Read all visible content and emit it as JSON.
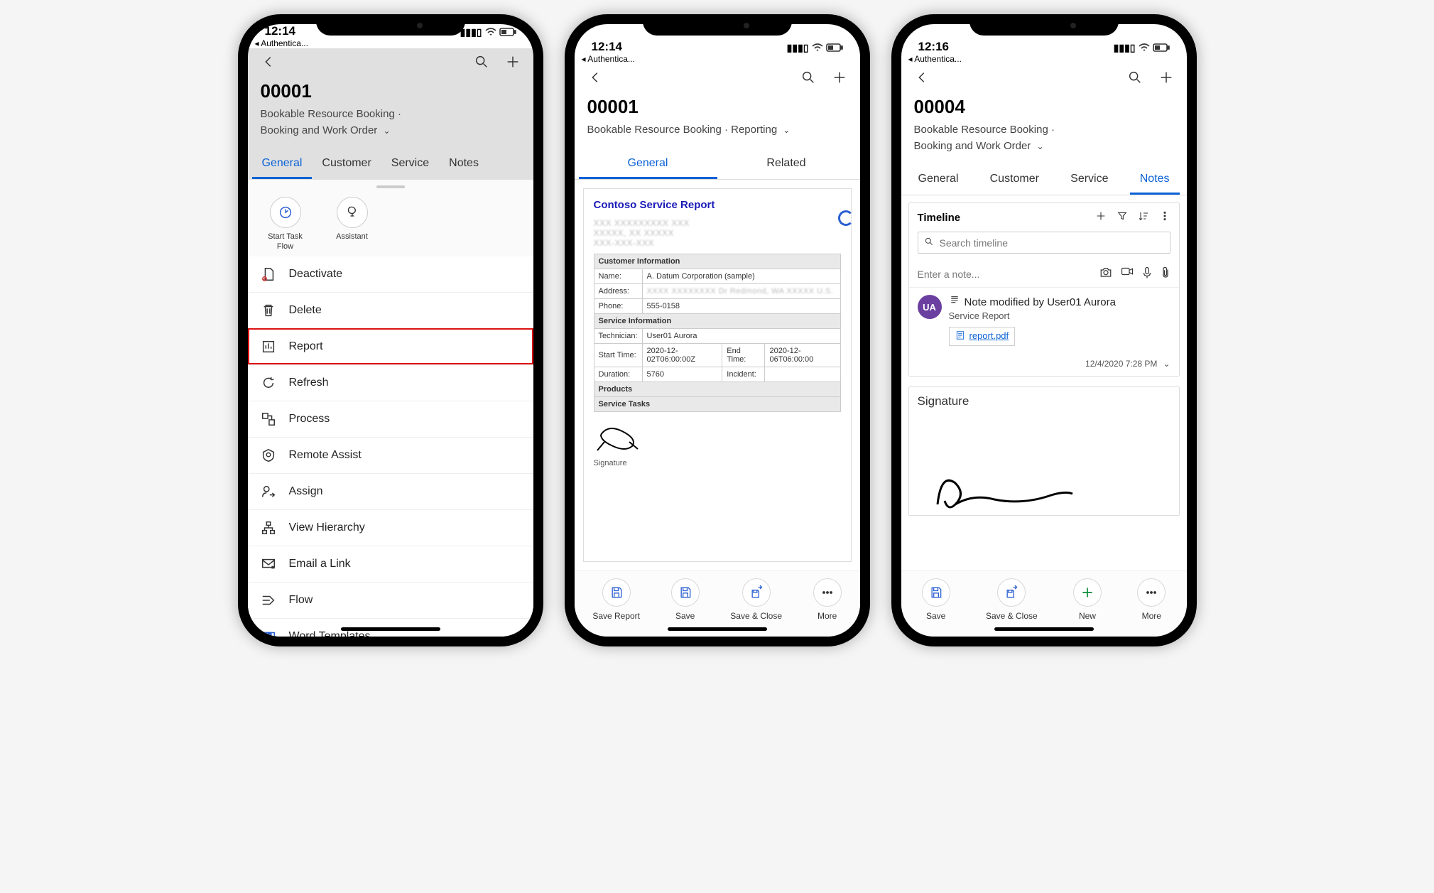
{
  "status": {
    "time1": "12:14",
    "time2": "12:14",
    "time3": "12:16",
    "back_app": "◂ Authentica..."
  },
  "phone1": {
    "title": "00001",
    "breadcrumb_line1": "Bookable Resource Booking  ·",
    "breadcrumb_line2": "Booking and Work Order",
    "tabs": [
      "General",
      "Customer",
      "Service",
      "Notes"
    ],
    "active_tab": 0,
    "quick": [
      {
        "label": "Start Task Flow"
      },
      {
        "label": "Assistant"
      }
    ],
    "menu": [
      "Deactivate",
      "Delete",
      "Report",
      "Refresh",
      "Process",
      "Remote Assist",
      "Assign",
      "View Hierarchy",
      "Email a Link",
      "Flow",
      "Word Templates"
    ],
    "highlight_index": 2
  },
  "phone2": {
    "title": "00001",
    "breadcrumb": "Bookable Resource Booking  ·  Reporting",
    "tabs": [
      "General",
      "Related"
    ],
    "active_tab": 0,
    "report": {
      "heading": "Contoso Service Report",
      "sections": {
        "cust_info": "Customer Information",
        "name_lbl": "Name:",
        "name_val": "A. Datum Corporation (sample)",
        "addr_lbl": "Address:",
        "addr_val": "",
        "phone_lbl": "Phone:",
        "phone_val": "555-0158",
        "svc_info": "Service Information",
        "tech_lbl": "Technician:",
        "tech_val": "User01 Aurora",
        "start_lbl": "Start Time:",
        "start_val": "2020-12-02T06:00:00Z",
        "end_lbl": "End Time:",
        "end_val": "2020-12-06T06:00:00",
        "dur_lbl": "Duration:",
        "dur_val": "5760",
        "inc_lbl": "Incident:",
        "inc_val": "",
        "products": "Products",
        "tasks": "Service Tasks",
        "sig_caption": "Signature"
      }
    },
    "bottom": [
      "Save Report",
      "Save",
      "Save & Close",
      "More"
    ]
  },
  "phone3": {
    "title": "00004",
    "breadcrumb_line1": "Bookable Resource Booking  ·",
    "breadcrumb_line2": "Booking and Work Order",
    "tabs": [
      "General",
      "Customer",
      "Service",
      "Notes"
    ],
    "active_tab": 3,
    "timeline": {
      "header": "Timeline",
      "search_placeholder": "Search timeline",
      "enter_note": "Enter a note...",
      "item": {
        "avatar": "UA",
        "title": "Note modified by User01 Aurora",
        "subtitle": "Service Report",
        "attachment": "report.pdf",
        "timestamp": "12/4/2020 7:28 PM"
      }
    },
    "signature_header": "Signature",
    "bottom": [
      "Save",
      "Save & Close",
      "New",
      "More"
    ]
  }
}
